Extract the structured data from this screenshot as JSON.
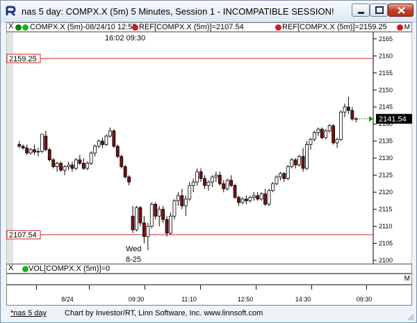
{
  "window": {
    "title": "nas 5 day: COMPX.X (5m) 5 Minutes, Session 1 - INCOMPATIBLE SESSION!"
  },
  "legend": {
    "close_glyph": "X",
    "series_label": "COMPX.X (5m)-08/24/10 12:55",
    "ref1_label": "REF[COMPX.X (5m)]=2107.54",
    "ref2_label": "REF[COMPX.X (5m)]=2159.25",
    "menu_glyph": "M",
    "dot_colors": [
      "#0e7a0e",
      "#1bb21b",
      "#d01b1b",
      "#d01b1b",
      "#d01b1b"
    ]
  },
  "time_note": "16:02  09:30",
  "session_label": {
    "line1": "Wed",
    "line2": "8-25"
  },
  "volume": {
    "close_glyph": "X",
    "label": "VOL[COMPX.X (5m)]=0",
    "menu_glyph": "M"
  },
  "time_axis": {
    "labels": [
      "8/24",
      "09:30",
      "11:10",
      "12:50",
      "14:30",
      "09:30"
    ]
  },
  "status": {
    "tab": "*nas 5 day",
    "note": "Chart by Investor/RT, Linn Software, Inc. www.linnsoft.com"
  },
  "chart_data": {
    "type": "candlestick",
    "price_axis": {
      "ticks": [
        2100,
        2105,
        2110,
        2115,
        2120,
        2125,
        2130,
        2135,
        2140,
        2145,
        2150,
        2155,
        2160,
        2165
      ],
      "range": [
        2099,
        2167
      ]
    },
    "reference_lines": [
      {
        "label": "2159.25",
        "value": 2159.25,
        "color": "#d02020"
      },
      {
        "label": "2107.54",
        "value": 2107.54,
        "color": "#d02020"
      }
    ],
    "last_price": {
      "label": "2141.54",
      "value": 2141.54
    },
    "candles": [
      [
        2134,
        2135,
        2133,
        2133.5
      ],
      [
        2133.5,
        2134,
        2132.5,
        2133
      ],
      [
        2133,
        2134,
        2131,
        2131.5
      ],
      [
        2131.5,
        2133,
        2131,
        2132.5
      ],
      [
        2132.5,
        2134,
        2131,
        2131.8
      ],
      [
        2131.8,
        2133,
        2130.5,
        2132
      ],
      [
        2132,
        2137,
        2131.5,
        2137
      ],
      [
        2136.5,
        2138,
        2132,
        2132.5
      ],
      [
        2132.5,
        2133,
        2129,
        2129.5
      ],
      [
        2129.5,
        2130,
        2127,
        2127.5
      ],
      [
        2127.5,
        2129,
        2126,
        2128.5
      ],
      [
        2128.5,
        2129,
        2126,
        2126.5
      ],
      [
        2126.5,
        2128,
        2125,
        2127.5
      ],
      [
        2127.5,
        2129,
        2126.5,
        2128
      ],
      [
        2128,
        2129,
        2126,
        2127
      ],
      [
        2127,
        2130,
        2126.5,
        2129.5
      ],
      [
        2129.5,
        2131,
        2128,
        2128.5
      ],
      [
        2128.5,
        2130,
        2126.5,
        2127
      ],
      [
        2127,
        2129,
        2126.5,
        2128.5
      ],
      [
        2128.5,
        2132,
        2128,
        2131.5
      ],
      [
        2131.5,
        2134,
        2130.5,
        2133.5
      ],
      [
        2133.5,
        2135.5,
        2133,
        2135
      ],
      [
        2135,
        2136,
        2133,
        2134
      ],
      [
        2134,
        2137,
        2133.5,
        2136.5
      ],
      [
        2136.5,
        2139,
        2136,
        2138
      ],
      [
        2138,
        2138.5,
        2133,
        2133.5
      ],
      [
        2133.5,
        2134,
        2130,
        2130.5
      ],
      [
        2130.5,
        2131,
        2127,
        2127.5
      ],
      [
        2127.5,
        2128,
        2124,
        2124.5
      ],
      [
        2124.5,
        2125,
        2122,
        2123
      ],
      [
        2113,
        2116,
        2108,
        2109
      ],
      [
        2109,
        2116,
        2108.5,
        2115.5
      ],
      [
        2115.5,
        2116,
        2110,
        2111
      ],
      [
        2111,
        2113,
        2105,
        2107
      ],
      [
        2107,
        2111,
        2103,
        2110
      ],
      [
        2110,
        2117,
        2109.5,
        2116.5
      ],
      [
        2116.5,
        2117,
        2112,
        2113
      ],
      [
        2113,
        2116,
        2110,
        2115
      ],
      [
        2115,
        2116,
        2111,
        2112
      ],
      [
        2112,
        2113,
        2107,
        2108
      ],
      [
        2108,
        2114,
        2107.5,
        2113
      ],
      [
        2113,
        2118,
        2112,
        2117.5
      ],
      [
        2117.5,
        2120,
        2116,
        2119
      ],
      [
        2119,
        2121,
        2115,
        2116
      ],
      [
        2116,
        2119,
        2113,
        2118
      ],
      [
        2118,
        2123,
        2117.5,
        2122
      ],
      [
        2122,
        2124,
        2120,
        2123
      ],
      [
        2123,
        2127,
        2122,
        2126
      ],
      [
        2126,
        2127,
        2123,
        2124
      ],
      [
        2124,
        2125,
        2121,
        2122
      ],
      [
        2122,
        2123.5,
        2120.5,
        2123
      ],
      [
        2123,
        2125,
        2121.5,
        2124.5
      ],
      [
        2124.5,
        2126,
        2123,
        2125
      ],
      [
        2125,
        2126,
        2122,
        2122.5
      ],
      [
        2122.5,
        2123.5,
        2120,
        2121
      ],
      [
        2121,
        2124,
        2120.5,
        2123.5
      ],
      [
        2123.5,
        2125,
        2121.5,
        2122
      ],
      [
        2122,
        2122.5,
        2118,
        2118.5
      ],
      [
        2118.5,
        2119,
        2116,
        2117
      ],
      [
        2117,
        2118.5,
        2116.5,
        2118
      ],
      [
        2118,
        2119,
        2116.5,
        2117.5
      ],
      [
        2117.5,
        2119,
        2117,
        2118.5
      ],
      [
        2118.5,
        2120,
        2117.5,
        2119
      ],
      [
        2119,
        2120,
        2117.5,
        2118
      ],
      [
        2118,
        2120,
        2117.5,
        2119.5
      ],
      [
        2119.5,
        2121,
        2116,
        2116.5
      ],
      [
        2116.5,
        2121,
        2116,
        2120.5
      ],
      [
        2120.5,
        2123,
        2120,
        2122.5
      ],
      [
        2122.5,
        2125,
        2122,
        2124.5
      ],
      [
        2124.5,
        2126,
        2123.5,
        2125.5
      ],
      [
        2125.5,
        2126,
        2123,
        2124
      ],
      [
        2124,
        2128,
        2123.5,
        2127.5
      ],
      [
        2127.5,
        2130,
        2127,
        2129.5
      ],
      [
        2129.5,
        2130,
        2127,
        2128
      ],
      [
        2128,
        2131,
        2127.5,
        2130.5
      ],
      [
        2130.5,
        2133,
        2126,
        2127
      ],
      [
        2127,
        2135,
        2126.5,
        2134
      ],
      [
        2134,
        2136,
        2132.5,
        2135.5
      ],
      [
        2135.5,
        2138,
        2135,
        2137.5
      ],
      [
        2137.5,
        2139,
        2136.5,
        2138.5
      ],
      [
        2138.5,
        2139,
        2135.5,
        2136
      ],
      [
        2136,
        2138.5,
        2135.5,
        2138
      ],
      [
        2138,
        2140,
        2137.5,
        2139.5
      ],
      [
        2139.5,
        2140,
        2134,
        2134.5
      ],
      [
        2134.5,
        2136,
        2133,
        2135.5
      ],
      [
        2135.5,
        2144,
        2135,
        2143.5
      ],
      [
        2143.5,
        2146,
        2142,
        2145
      ],
      [
        2145,
        2148,
        2143,
        2144
      ],
      [
        2144,
        2145,
        2141,
        2141.5
      ],
      [
        2141.5,
        2142,
        2140.5,
        2141.54
      ]
    ]
  }
}
